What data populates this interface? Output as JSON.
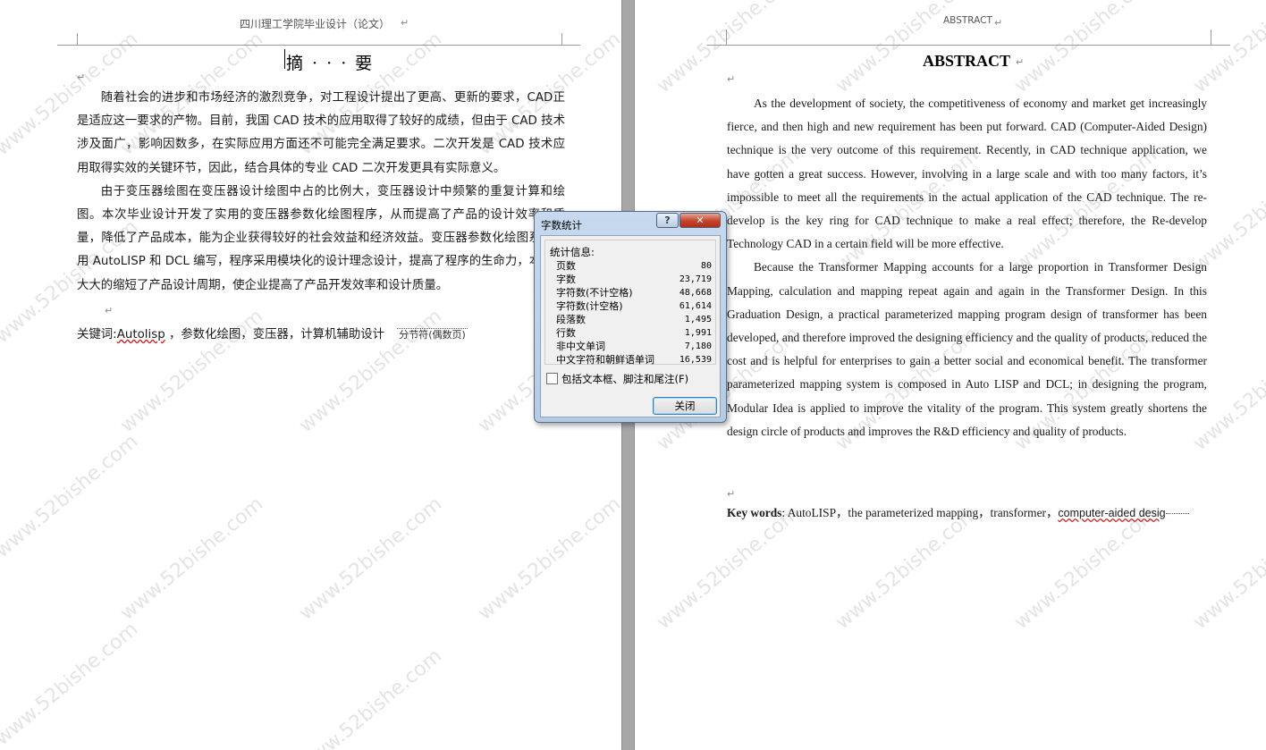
{
  "watermark": "www.52bishe.com",
  "left_page": {
    "header": "四川理工学院毕业设计（论文）",
    "title": "摘 · · · 要",
    "paragraphs": [
      "随着社会的进步和市场经济的激烈竞争，对工程设计提出了更高、更新的要求，CAD正是适应这一要求的产物。目前，我国 CAD 技术的应用取得了较好的成绩，但由于 CAD 技术涉及面广，影响因数多，在实际应用方面还不可能完全满足要求。二次开发是 CAD 技术应用取得实效的关键环节，因此，结合具体的专业 CAD 二次开发更具有实际意义。",
      "由于变压器绘图在变压器设计绘图中占的比例大，变压器设计中频繁的重复计算和绘图。本次毕业设计开发了实用的变压器参数化绘图程序，从而提高了产品的设计效率和质量，降低了产品成本，能为企业获得较好的社会效益和经济效益。变压器参数化绘图系统使用 AutoLISP 和 DCL 编写，程序采用模块化的设计理念设计，提高了程序的生命力，本系统大大的缩短了产品设计周期，使企业提高了产品开发效率和设计质量。"
    ],
    "keywords_label": "关键词:",
    "keywords_link": "Autolisp",
    "keywords_rest": " ，参数化绘图，变压器，计算机辅助设计",
    "section_break": "分节符(偶数页)"
  },
  "right_page": {
    "header": "ABSTRACT",
    "title": "ABSTRACT",
    "paragraphs": [
      "As the development of society, the competitiveness of economy and market get increasingly fierce, and then high and new requirement has been put forward. CAD (Computer-Aided Design) technique is the very outcome of this requirement. Recently, in CAD technique application, we have gotten a great success. However, involving in a large scale and with too many factors, it’s impossible to meet all the requirements in the actual application of the CAD technique. The re-develop is the key ring for CAD technique to make a real effect; therefore, the Re-develop Technology CAD in a certain field will be more effective.",
      "Because the Transformer Mapping accounts for a large proportion in Transformer Design Mapping, calculation and mapping repeat again and again in the Transformer Design. In this Graduation Design, a practical parameterized mapping program design of transformer has been developed, and therefore improved the designing efficiency and the quality of products, reduced the cost and is helpful for enterprises to gain a better social and economical benefit. The transformer parameterized mapping system is composed in Auto LISP and DCL; in designing the program, Modular Idea is applied to improve the vitality of the program. This system greatly shortens the design circle of products and improves the R&D efficiency and quality of products."
    ],
    "keywords_label": "Key words",
    "keywords_rest": ": AutoLISP，the parameterized mapping，transformer，",
    "keywords_tail": "computer-aided desig"
  },
  "dialog": {
    "title": "字数统计",
    "help_label": "?",
    "close_x": "✕",
    "stats_label": "统计信息:",
    "stats": [
      {
        "label": "页数",
        "value": "80"
      },
      {
        "label": "字数",
        "value": "23,719"
      },
      {
        "label": "字符数(不计空格)",
        "value": "48,668"
      },
      {
        "label": "字符数(计空格)",
        "value": "61,614"
      },
      {
        "label": "段落数",
        "value": "1,495"
      },
      {
        "label": "行数",
        "value": "1,991"
      },
      {
        "label": "非中文单词",
        "value": "7,180"
      },
      {
        "label": "中文字符和朝鲜语单词",
        "value": "16,539"
      }
    ],
    "checkbox_label": "包括文本框、脚注和尾注(F)",
    "checkbox_checked": false,
    "close_button": "关闭"
  }
}
